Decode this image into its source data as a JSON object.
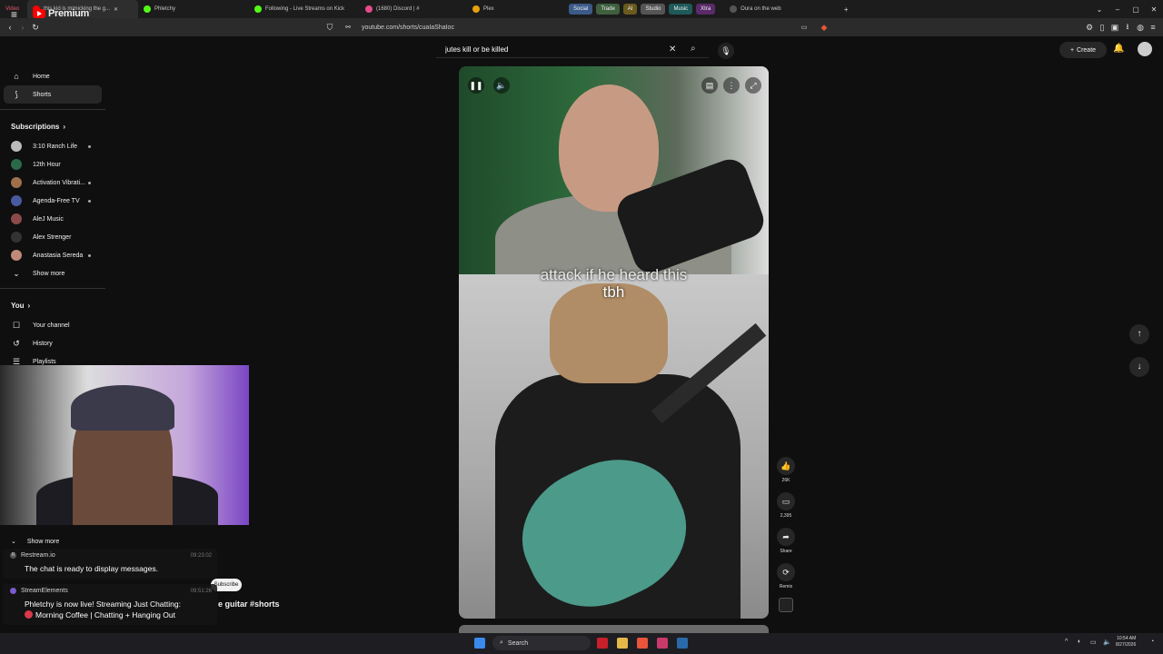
{
  "browser": {
    "tabs": [
      {
        "label": "Video"
      },
      {
        "label": "this kid is mimicking the g..."
      },
      {
        "label": "Phletchy"
      },
      {
        "label": "Following - Live Streams on Kick"
      },
      {
        "label": "(1680) Discord | #"
      },
      {
        "label": "Plex"
      }
    ],
    "groups": [
      {
        "label": "Social",
        "color": "#3b5a8a"
      },
      {
        "label": "Trade",
        "color": "#3f5f3f"
      },
      {
        "label": "AI",
        "color": "#6a5a1e"
      },
      {
        "label": "Studio",
        "color": "#555555"
      },
      {
        "label": "Music",
        "color": "#1f5a5a"
      },
      {
        "label": "Xtra",
        "color": "#5a2a6a"
      }
    ],
    "extra_tab": "Oura on the web",
    "url": "youtube.com/shorts/cuaIaShaIoc"
  },
  "header": {
    "logo_text": "Premium",
    "search_value": "jutes kill or be killed",
    "create_label": "Create"
  },
  "sidebar": {
    "home": "Home",
    "shorts": "Shorts",
    "subscriptions_heading": "Subscriptions",
    "subscriptions": [
      {
        "name": "3:10 Ranch Life"
      },
      {
        "name": "12th Hour"
      },
      {
        "name": "Activation Vibrati..."
      },
      {
        "name": "Agenda-Free TV"
      },
      {
        "name": "AleJ Music"
      },
      {
        "name": "Alex Strenger"
      },
      {
        "name": "Anastasia Sereda"
      }
    ],
    "show_more": "Show more",
    "you_heading": "You",
    "you_items": [
      {
        "name": "Your channel"
      },
      {
        "name": "History"
      },
      {
        "name": "Playlists"
      }
    ]
  },
  "video": {
    "caption_line1": "attack if he heard this",
    "caption_line2": "tbh"
  },
  "actions": {
    "like_count": "26K",
    "comment_count": "2,395",
    "share_label": "Share",
    "remix_label": "Remix"
  },
  "background_text": {
    "show_more": "Show more",
    "subscribe": "Subscribe",
    "title_peek": "e guitar #shorts"
  },
  "chat": {
    "messages": [
      {
        "source": "Restream.io",
        "time": "09:23:02",
        "text": "The chat is ready to display messages."
      },
      {
        "source": "StreamElements",
        "time": "09:51:26",
        "text": "Phletchy is now live! Streaming Just Chatting: ",
        "text2": "Morning Coffee | Chatting + Hanging Out"
      }
    ]
  },
  "taskbar": {
    "search_label": "Search",
    "time": "10:54 AM",
    "date": "8/27/2026"
  }
}
